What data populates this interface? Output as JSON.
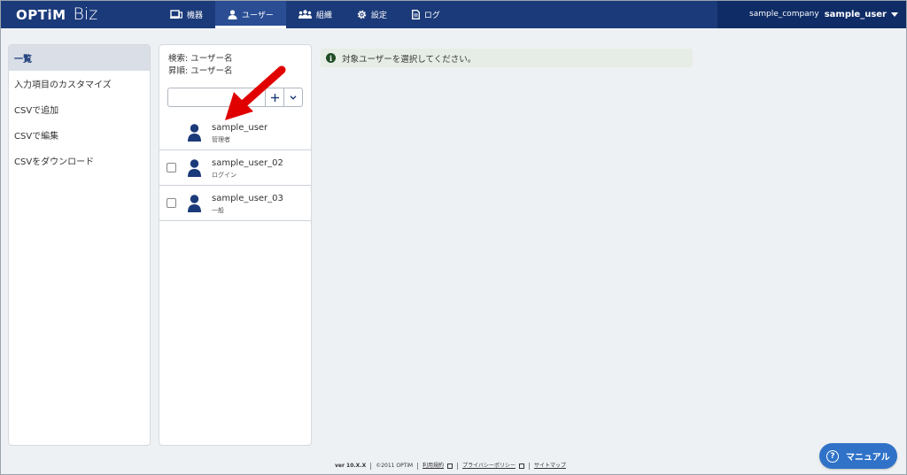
{
  "header": {
    "logo_main": "OPTiM",
    "logo_sub": "Biz",
    "nav": [
      {
        "label": "機器",
        "icon": "device-icon"
      },
      {
        "label": "ユーザー",
        "icon": "user-icon"
      },
      {
        "label": "組織",
        "icon": "organization-icon"
      },
      {
        "label": "設定",
        "icon": "gear-icon"
      },
      {
        "label": "ログ",
        "icon": "log-icon"
      }
    ],
    "active_nav": "ユーザー",
    "company": "sample_company",
    "user": "sample_user"
  },
  "sidebar": {
    "items": [
      {
        "label": "一覧",
        "active": true
      },
      {
        "label": "入力項目のカスタマイズ"
      },
      {
        "label": "CSVで追加"
      },
      {
        "label": "CSVで編集"
      },
      {
        "label": "CSVをダウンロード"
      }
    ]
  },
  "user_list": {
    "search_label": "検索: ユーザー名",
    "sort_label": "昇順: ユーザー名",
    "search_value": "",
    "users": [
      {
        "name": "sample_user",
        "role": "管理者",
        "checkbox": false
      },
      {
        "name": "sample_user_02",
        "role": "ログイン",
        "checkbox": true
      },
      {
        "name": "sample_user_03",
        "role": "一般",
        "checkbox": true
      }
    ]
  },
  "info_message": "対象ユーザーを選択してください。",
  "footer": {
    "version": "ver 10.X.X",
    "copyright": "©2011 OPTiM",
    "terms": "利用規約",
    "privacy": "プライバシーポリシー",
    "sitemap": "サイトマップ"
  },
  "manual_button": "マニュアル",
  "colors": {
    "header_bg": "#1b3a7a",
    "account_bg": "#0f2c66",
    "accent": "#1b3a7a",
    "manual_bg": "#2f72c8",
    "annotation_arrow": "#e00000"
  }
}
